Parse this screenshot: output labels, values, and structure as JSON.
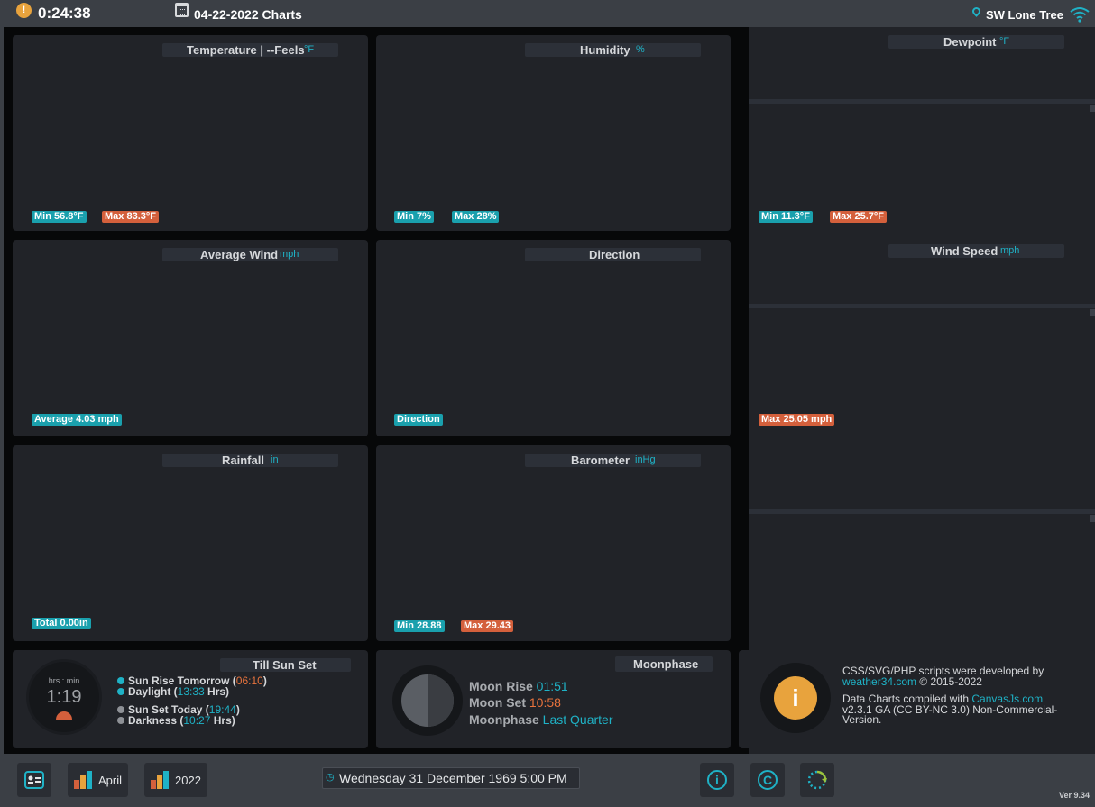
{
  "header": {
    "elapsed_time": "0:24:38",
    "title": "04-22-2022 Charts",
    "location": "SW Lone Tree"
  },
  "charts": {
    "temperature": {
      "title": "Temperature | --Feels",
      "unit": "°F",
      "min": "Min 56.8°F",
      "max": "Max 83.3°F"
    },
    "humidity": {
      "title": "Humidity",
      "unit": "%",
      "min": "Min 7%",
      "max": "Max 28%"
    },
    "dewpoint": {
      "title": "Dewpoint",
      "unit": "°F",
      "min": "Min 11.3°F",
      "max": "Max 25.7°F"
    },
    "average_wind": {
      "title": "Average Wind",
      "unit": "mph",
      "badge": "Average 4.03 mph"
    },
    "direction": {
      "title": "Direction",
      "badge": "Direction"
    },
    "wind_speed": {
      "title": "Wind Speed",
      "unit": "mph",
      "badge": "Max 25.05 mph"
    },
    "rainfall": {
      "title": "Rainfall",
      "unit": "in",
      "badge": "Total 0.00in"
    },
    "barometer": {
      "title": "Barometer",
      "unit": "inHg",
      "min": "Min 28.88",
      "max": "Max 29.43"
    }
  },
  "sun": {
    "title": "Till Sun Set",
    "clock_label": "hrs : min",
    "clock_value": "1:19",
    "rise_label": "Sun Rise Tomorrow (",
    "rise_value": "06:10",
    "daylight_label": "Daylight (",
    "daylight_value": "13:33",
    "daylight_suffix": " Hrs)",
    "set_label": "Sun Set Today (",
    "set_value": "19:44",
    "darkness_label": "Darkness (",
    "darkness_value": "10:27",
    "darkness_suffix": " Hrs)",
    "close_paren": ")"
  },
  "moon": {
    "title": "Moonphase",
    "rise_label": "Moon Rise",
    "rise_value": "01:51",
    "set_label": "Moon Set",
    "set_value": "10:58",
    "phase_label": "Moonphase",
    "phase_value": "Last Quarter"
  },
  "credits": {
    "line1": "CSS/SVG/PHP scripts were developed by",
    "link1": "weather34.com",
    "line1b": " © 2015-2022",
    "line2": "Data Charts compiled with ",
    "link2": "CanvasJs.com",
    "line3": "v2.3.1 GA (CC BY-NC 3.0) Non-Commercial-",
    "line4": "Version."
  },
  "footer": {
    "month_label": "April",
    "year_label": "2022",
    "datetime": "Wednesday 31 December 1969 5:00 PM",
    "info_glyph": "i",
    "copyright_glyph": "C",
    "version": "Ver 9.34"
  },
  "colors": {
    "accent_teal": "#1fb2c6",
    "accent_orange": "#e8733d",
    "min_badge": "#1aa0ad",
    "max_badge": "#d4603c",
    "info_orange": "#e8a33d"
  }
}
